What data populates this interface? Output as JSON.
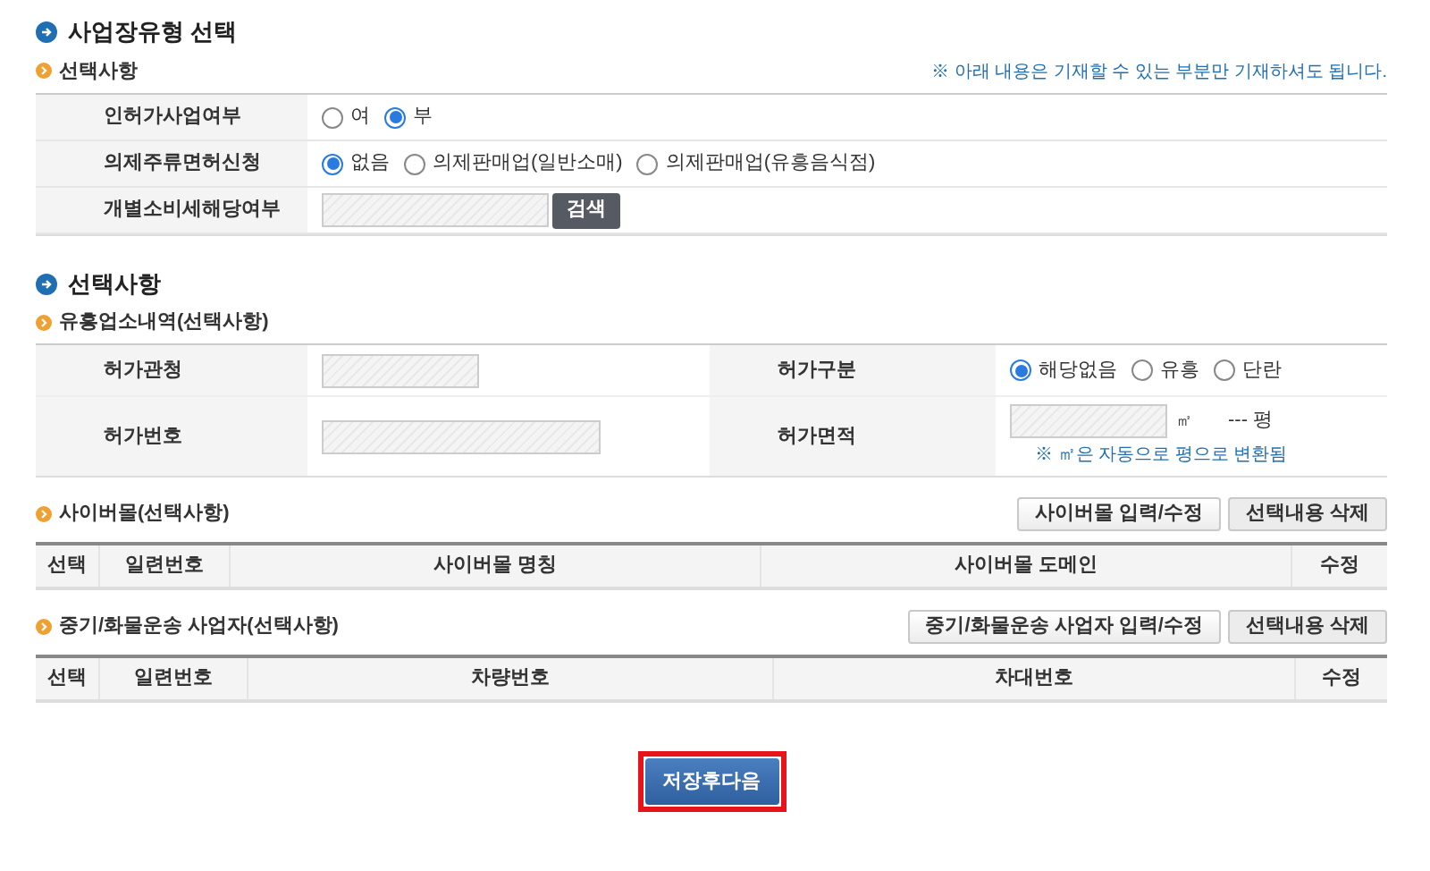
{
  "section1": {
    "title": "사업장유형 선택",
    "subtitle": "선택사항",
    "note": "※ 아래 내용은 기재할 수 있는 부분만 기재하셔도 됩니다.",
    "rows": [
      {
        "label": "인허가사업여부",
        "kind": "radio",
        "options": [
          {
            "label": "여",
            "selected": false
          },
          {
            "label": "부",
            "selected": true
          }
        ]
      },
      {
        "label": "의제주류면허신청",
        "kind": "radio",
        "options": [
          {
            "label": "없음",
            "selected": true
          },
          {
            "label": "의제판매업(일반소매)",
            "selected": false
          },
          {
            "label": "의제판매업(유흥음식점)",
            "selected": false
          }
        ]
      },
      {
        "label": "개별소비세해당여부",
        "kind": "search",
        "button": "검색"
      }
    ]
  },
  "section2": {
    "title": "선택사항",
    "subtitle": "유흥업소내역(선택사항)",
    "license_office": {
      "label": "허가관청"
    },
    "license_type": {
      "label": "허가구분",
      "options": [
        {
          "label": "해당없음",
          "selected": true
        },
        {
          "label": "유흥",
          "selected": false
        },
        {
          "label": "단란",
          "selected": false
        }
      ]
    },
    "license_number": {
      "label": "허가번호"
    },
    "license_area": {
      "label": "허가면적",
      "unit": "㎡",
      "pyeong": "--- 평",
      "note": "※ ㎡은 자동으로 평으로 변환됨"
    }
  },
  "tables": [
    {
      "title": "사이버몰(선택사항)",
      "buttons": [
        "사이버몰 입력/수정",
        "선택내용 삭제"
      ],
      "columns": [
        "선택",
        "일련번호",
        "사이버몰 명칭",
        "사이버몰 도메인",
        "수정"
      ]
    },
    {
      "title": "중기/화물운송 사업자(선택사항)",
      "buttons": [
        "중기/화물운송 사업자 입력/수정",
        "선택내용 삭제"
      ],
      "columns": [
        "선택",
        "일련번호",
        "차량번호",
        "차대번호",
        "수정"
      ]
    }
  ],
  "save_button": "저장후다음"
}
